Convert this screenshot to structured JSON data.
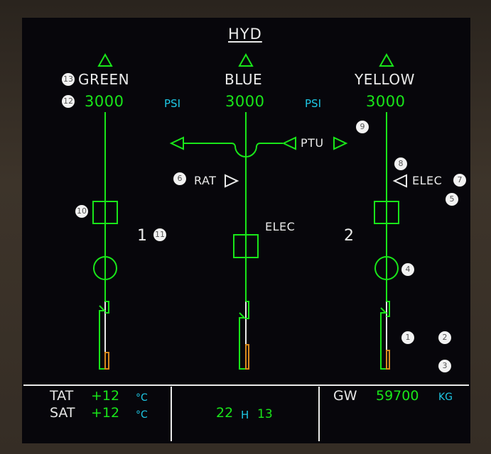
{
  "page": {
    "title": "HYD"
  },
  "systems": [
    {
      "name": "GREEN",
      "pressure": "3000",
      "pump_label": "1"
    },
    {
      "name": "BLUE",
      "pressure": "3000",
      "pump_label": "ELEC"
    },
    {
      "name": "YELLOW",
      "pressure": "3000",
      "pump_label": "2"
    }
  ],
  "units": {
    "psi_left": "PSI",
    "psi_right": "PSI"
  },
  "labels": {
    "ptu": "PTU",
    "rat": "RAT",
    "yellow_elec": "ELEC"
  },
  "callouts": [
    "1",
    "2",
    "3",
    "4",
    "5",
    "6",
    "7",
    "8",
    "9",
    "10",
    "11",
    "12",
    "13"
  ],
  "bottom": {
    "tat_label": "TAT",
    "tat_value": "+12",
    "tat_unit": "°C",
    "sat_label": "SAT",
    "sat_value": "+12",
    "sat_unit": "°C",
    "time_hours": "22",
    "time_sep": "H",
    "time_minutes": "13",
    "gw_label": "GW",
    "gw_value": "59700",
    "gw_unit": "KG"
  },
  "colors": {
    "green": "#19e619",
    "cyan": "#1ec8e6",
    "white": "#eaeaea",
    "amber": "#d88a1e"
  }
}
